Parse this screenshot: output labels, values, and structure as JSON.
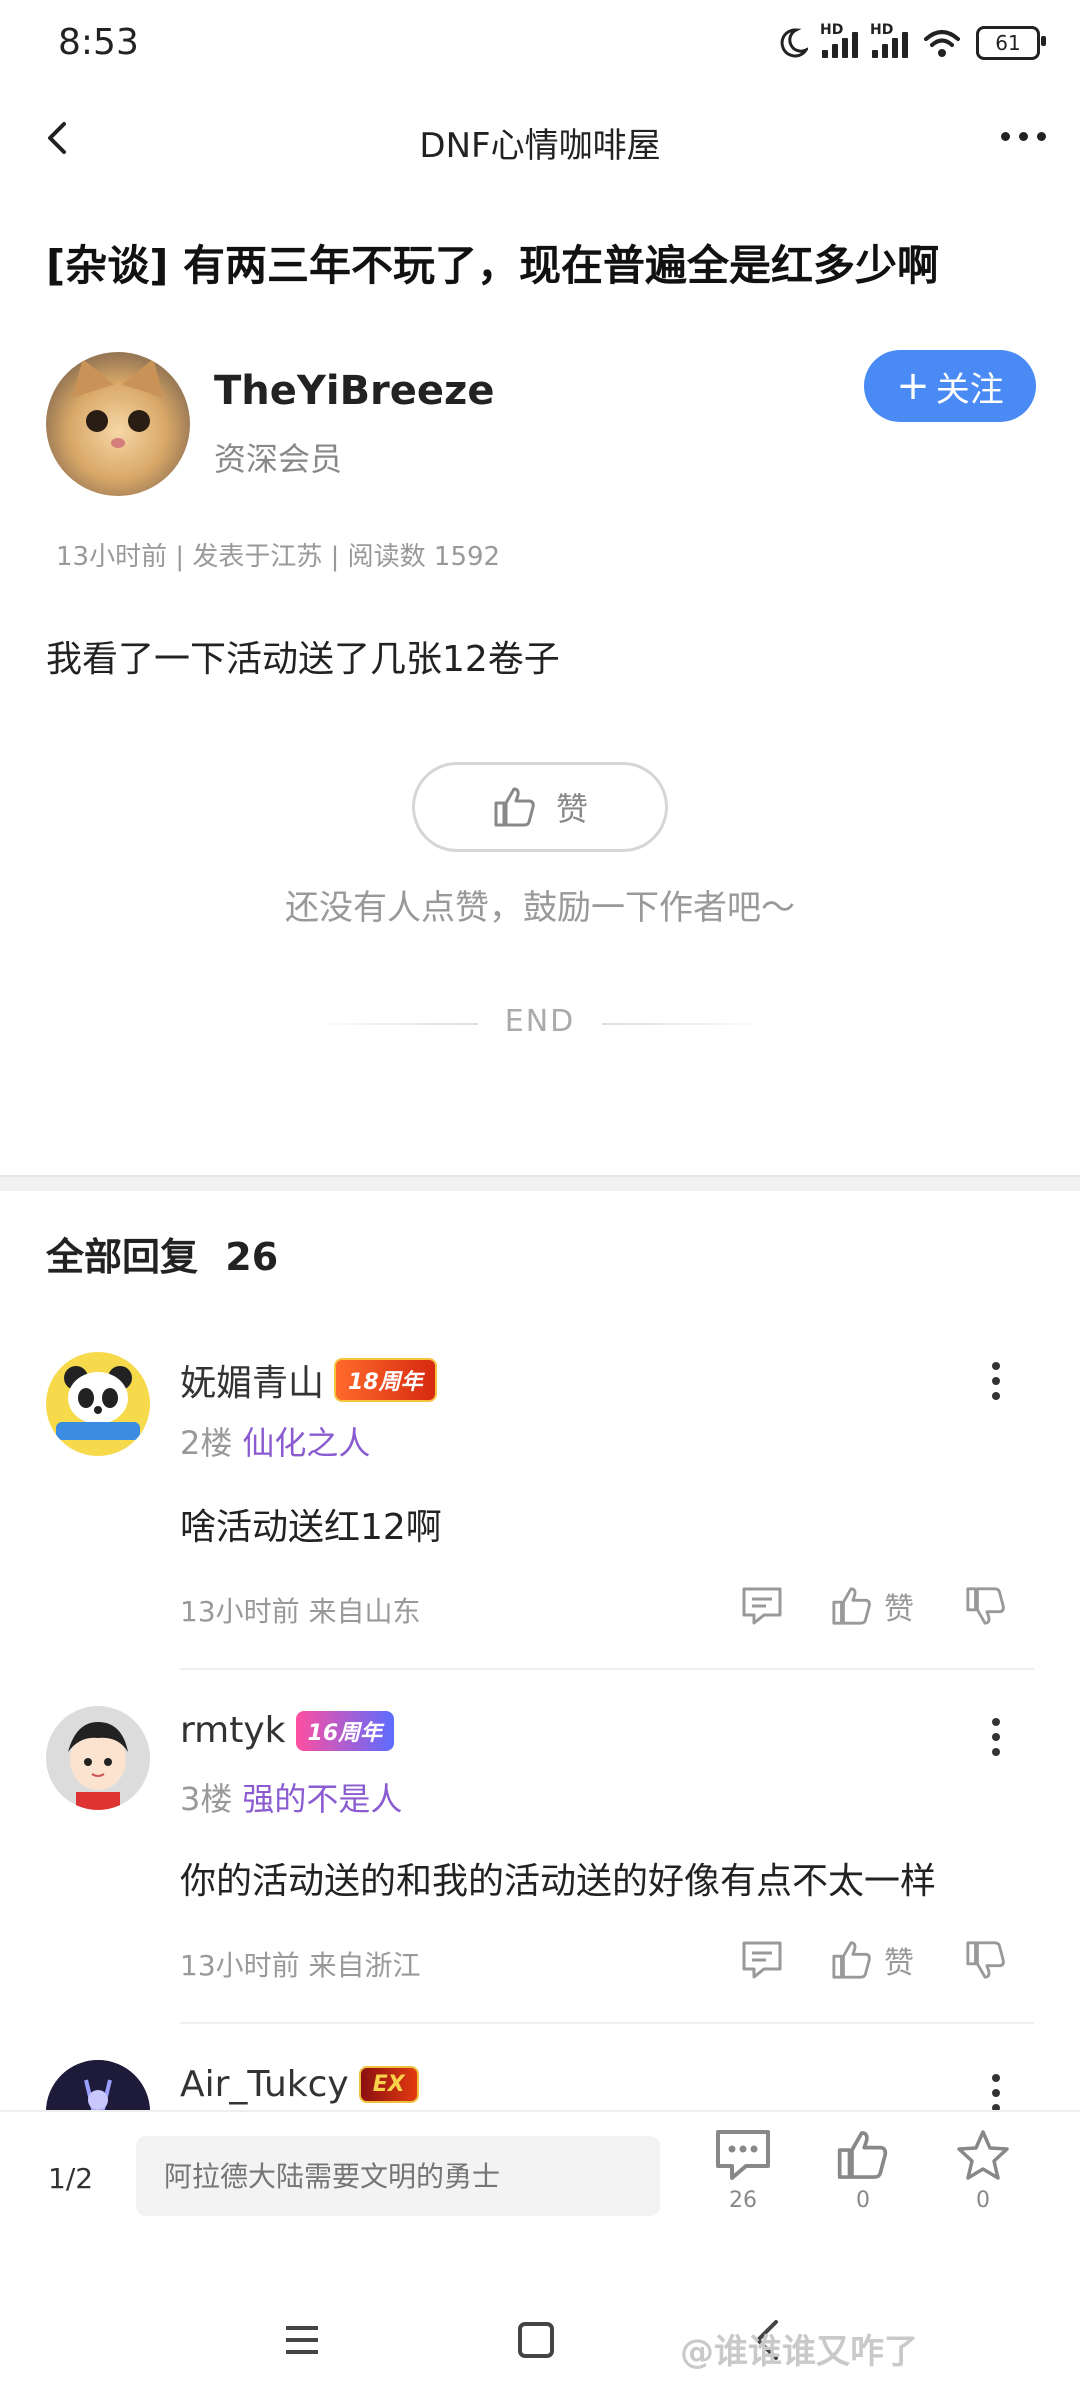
{
  "status_bar": {
    "time": "8:53",
    "hd1": "HD",
    "hd2": "HD",
    "battery": "61"
  },
  "nav": {
    "title": "DNF心情咖啡屋"
  },
  "post": {
    "title": "[杂谈] 有两三年不玩了，现在普遍全是红多少啊",
    "author": "TheYiBreeze",
    "author_role": "资深会员",
    "follow_label": "关注",
    "meta": "13小时前 | 发表于江苏 | 阅读数 1592",
    "body": "我看了一下活动送了几张12卷子",
    "like_label": "赞",
    "encourage": "还没有人点赞，鼓励一下作者吧～",
    "end": "END"
  },
  "replies_header": {
    "label": "全部回复",
    "count": "26"
  },
  "replies": [
    {
      "name": "妩媚青山",
      "badge": "18周年",
      "floor": "2楼",
      "title": "仙化之人",
      "text": "啥活动送红12啊",
      "meta": "13小时前 来自山东",
      "like_label": "赞"
    },
    {
      "name": "rmtyk",
      "badge": "16周年",
      "floor": "3楼",
      "title": "强的不是人",
      "text": "你的活动送的和我的活动送的好像有点不太一样",
      "meta": "13小时前 来自浙江",
      "like_label": "赞"
    },
    {
      "name": "Air_Tukcy",
      "badge": "EX"
    }
  ],
  "bottom_bar": {
    "page": "1/2",
    "input_placeholder": "阿拉德大陆需要文明的勇士",
    "comment_count": "26",
    "like_count": "0",
    "fav_count": "0"
  },
  "watermark": "@谁谁谁又咋了",
  "colors": {
    "accent": "#4a8af4",
    "title_purple": "#8a5cd0"
  }
}
